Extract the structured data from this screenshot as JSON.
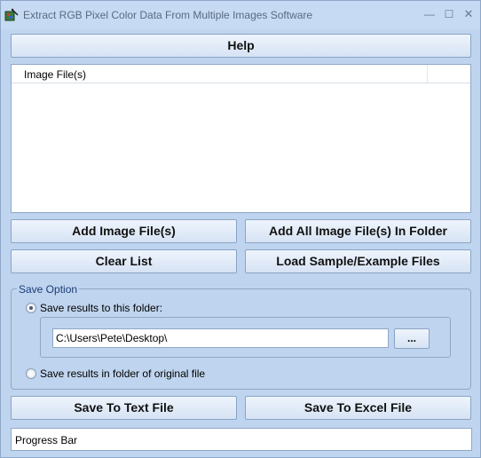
{
  "window": {
    "title": "Extract RGB Pixel Color Data From Multiple Images Software",
    "minimize_glyph": "—",
    "maximize_glyph": "☐",
    "close_glyph": "✕"
  },
  "buttons": {
    "help": "Help",
    "add_files": "Add Image File(s)",
    "add_folder": "Add All Image File(s) In Folder",
    "clear_list": "Clear List",
    "load_sample": "Load Sample/Example Files",
    "save_text": "Save To Text File",
    "save_excel": "Save To Excel File",
    "browse": "..."
  },
  "file_list": {
    "column_header": "Image File(s)",
    "rows": []
  },
  "save_option": {
    "legend": "Save Option",
    "option_folder": "Save results to this folder:",
    "option_original": "Save results in folder of original file",
    "selected": "folder",
    "folder_path": "C:\\Users\\Pete\\Desktop\\"
  },
  "progress": {
    "label": "Progress Bar",
    "value": 0
  },
  "colors": {
    "window_bg": "#bfd4ee",
    "accent_text": "#1c3d7a"
  }
}
